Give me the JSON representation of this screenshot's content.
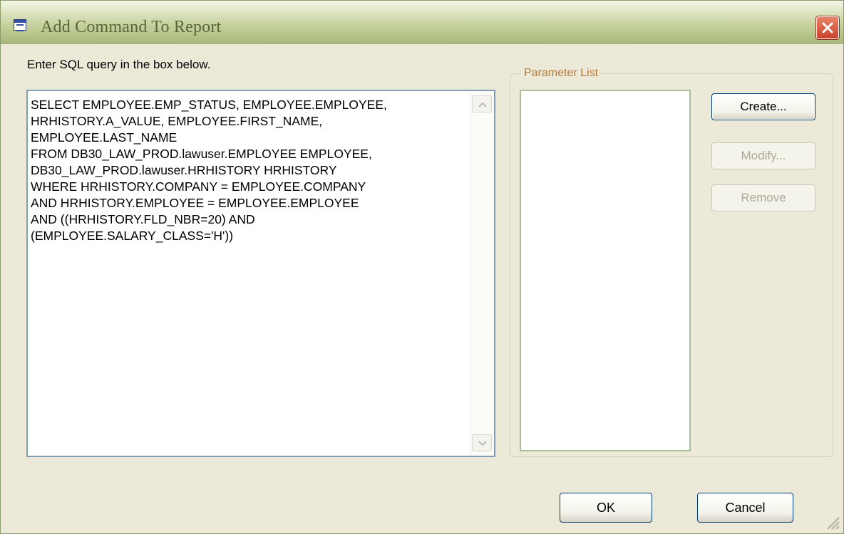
{
  "window": {
    "title": "Add Command To Report"
  },
  "sql": {
    "label": "Enter SQL query in the box below.",
    "query": "SELECT EMPLOYEE.EMP_STATUS, EMPLOYEE.EMPLOYEE,\nHRHISTORY.A_VALUE, EMPLOYEE.FIRST_NAME,\nEMPLOYEE.LAST_NAME\nFROM DB30_LAW_PROD.lawuser.EMPLOYEE EMPLOYEE,\nDB30_LAW_PROD.lawuser.HRHISTORY HRHISTORY\nWHERE HRHISTORY.COMPANY = EMPLOYEE.COMPANY\nAND HRHISTORY.EMPLOYEE = EMPLOYEE.EMPLOYEE\nAND ((HRHISTORY.FLD_NBR=20) AND\n(EMPLOYEE.SALARY_CLASS='H'))"
  },
  "parameters": {
    "legend": "Parameter List",
    "items": []
  },
  "buttons": {
    "create": "Create...",
    "modify": "Modify...",
    "remove": "Remove",
    "ok": "OK",
    "cancel": "Cancel"
  },
  "colors": {
    "titlebar": "#c7d2a0",
    "title_text": "#5a6638",
    "close": "#c9432a",
    "dialog_bg": "#ece9d8"
  }
}
